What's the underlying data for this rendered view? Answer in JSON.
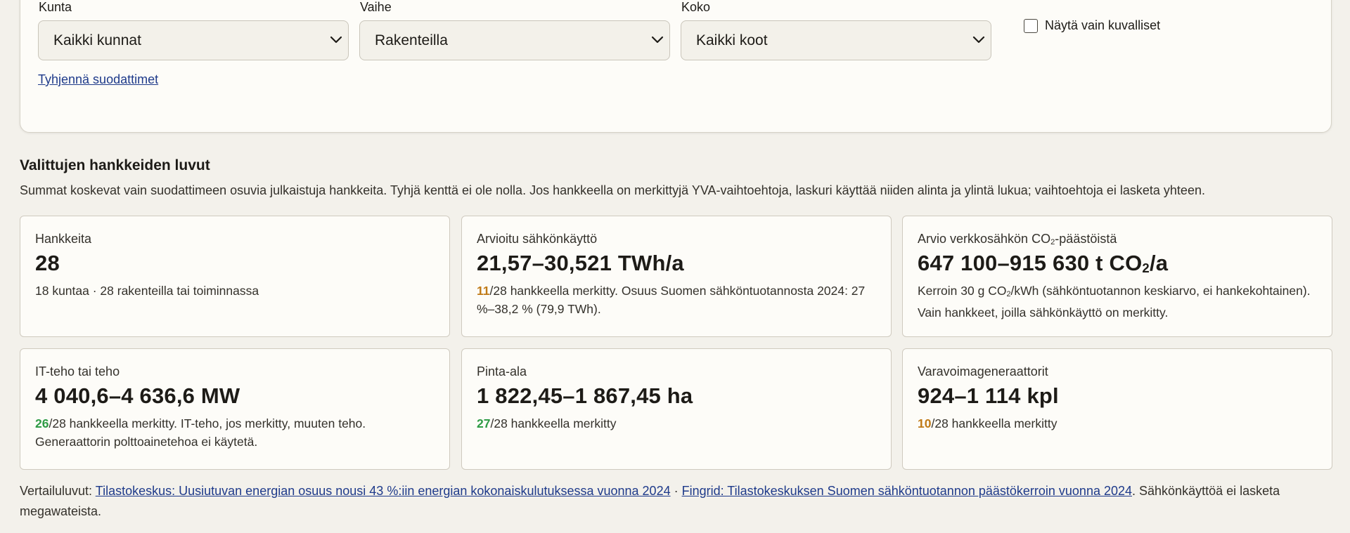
{
  "filters": {
    "municipality": {
      "label": "Kunta",
      "value": "Kaikki kunnat"
    },
    "phase": {
      "label": "Vaihe",
      "value": "Rakenteilla"
    },
    "size": {
      "label": "Koko",
      "value": "Kaikki koot"
    },
    "images_only": {
      "label": "Näytä vain kuvalliset",
      "checked": false
    },
    "clear_label": "Tyhjennä suodattimet"
  },
  "summary": {
    "title": "Valittujen hankkeiden luvut",
    "description": "Summat koskevat vain suodattimeen osuvia julkaistuja hankkeita. Tyhjä kenttä ei ole nolla. Jos hankkeella on merkittyjä YVA-vaihtoehtoja, laskuri käyttää niiden alinta ja ylintä lukua; vaihtoehtoja ei lasketa yhteen."
  },
  "cards": {
    "projects": {
      "label": "Hankkeita",
      "value": "28",
      "note": "18 kuntaa · 28 rakenteilla tai toiminnassa"
    },
    "electricity": {
      "label": "Arvioitu sähkönkäyttö",
      "value": "21,57–30,521 TWh/a",
      "count": "11",
      "note": "/28 hankkeella merkitty. Osuus Suomen sähköntuotannosta 2024: 27 %–38,2 % (79,9 TWh)."
    },
    "emissions": {
      "label_pre": "Arvio verkkosähkön CO",
      "label_sub": "2",
      "label_post": "-päästöistä",
      "value_pre": "647 100–915 630 t CO",
      "value_sub": "2",
      "value_post": "/a",
      "note_pre": "Kerroin 30 g CO",
      "note_sub": "2",
      "note_post": "/kWh (sähköntuotannon keskiarvo, ei hankekohtainen). Vain hankkeet, joilla sähkönkäyttö on merkitty."
    },
    "power": {
      "label": "IT-teho tai teho",
      "value": "4 040,6–4 636,6 MW",
      "count": "26",
      "note": "/28 hankkeella merkitty. IT-teho, jos merkitty, muuten teho. Generaattorin polttoainetehoa ei käytetä."
    },
    "area": {
      "label": "Pinta-ala",
      "value": "1 822,45–1 867,45 ha",
      "count": "27",
      "note": "/28 hankkeella merkitty"
    },
    "generators": {
      "label": "Varavoimageneraattorit",
      "value": "924–1 114 kpl",
      "count": "10",
      "note": "/28 hankkeella merkitty"
    }
  },
  "footer": {
    "prefix": "Vertailuluvut: ",
    "link1": "Tilastokeskus: Uusiutuvan energian osuus nousi 43 %:iin energian kokonaiskulutuksessa vuonna 2024",
    "separator": " · ",
    "link2": "Fingrid: Tilastokeskuksen Suomen sähköntuotannon päästökerroin vuonna 2024",
    "suffix": ". Sähkönkäyttöä ei lasketa megawateista."
  },
  "colors": {
    "accent_green": "#2e9b45",
    "accent_orange": "#c07a16",
    "link": "#1e3a8a"
  }
}
